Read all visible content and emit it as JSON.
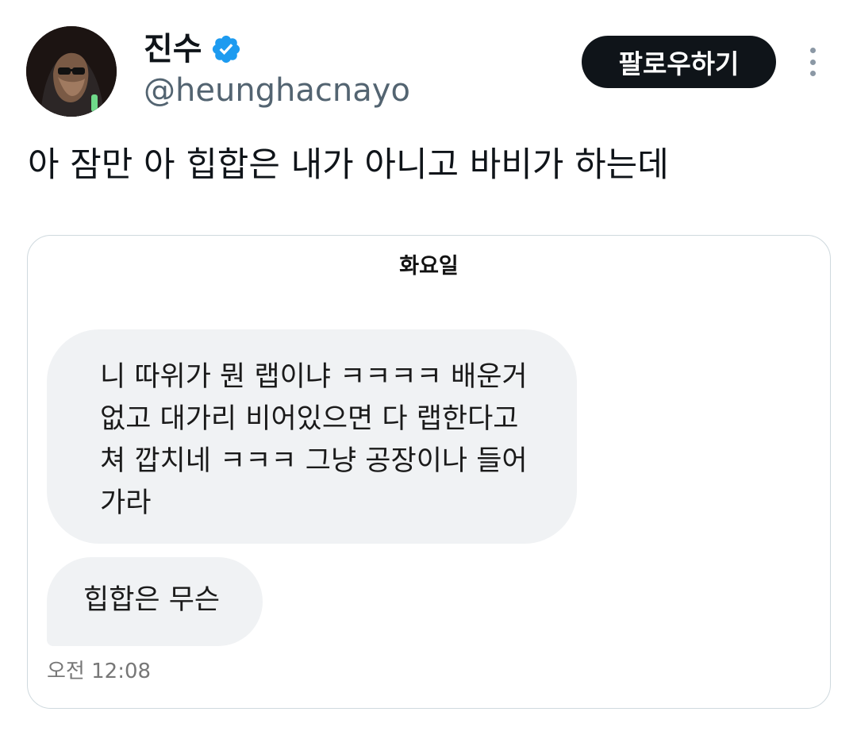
{
  "user": {
    "display_name": "진수",
    "handle": "@heunghacnayo",
    "avatar_icon": "avatar-image",
    "verified_icon": "verified-badge-icon",
    "verified_color": "#1d9bf0"
  },
  "actions": {
    "follow_label": "팔로우하기",
    "more_icon": "more-dots-icon"
  },
  "tweet": {
    "text": "아 잠만 아 힙합은 내가 아니고 바비가 하는데"
  },
  "media": {
    "chat_day": "화요일",
    "messages": [
      {
        "lines": [
          "니 따위가 뭔 랩이냐 ㅋㅋㅋㅋ 배운거",
          "없고 대가리 비어있으면 다 랩한다고",
          "쳐 깝치네 ㅋㅋㅋ 그냥 공장이나 들어",
          "가라"
        ]
      },
      {
        "lines": [
          "힙합은 무슨"
        ]
      }
    ],
    "time": "오전 12:08"
  },
  "colors": {
    "background": "#ffffff",
    "text": "#0f1419",
    "secondary_text": "#536471",
    "bubble": "#f0f2f4",
    "card_border": "#cfd9de",
    "button": "#0f1419"
  }
}
